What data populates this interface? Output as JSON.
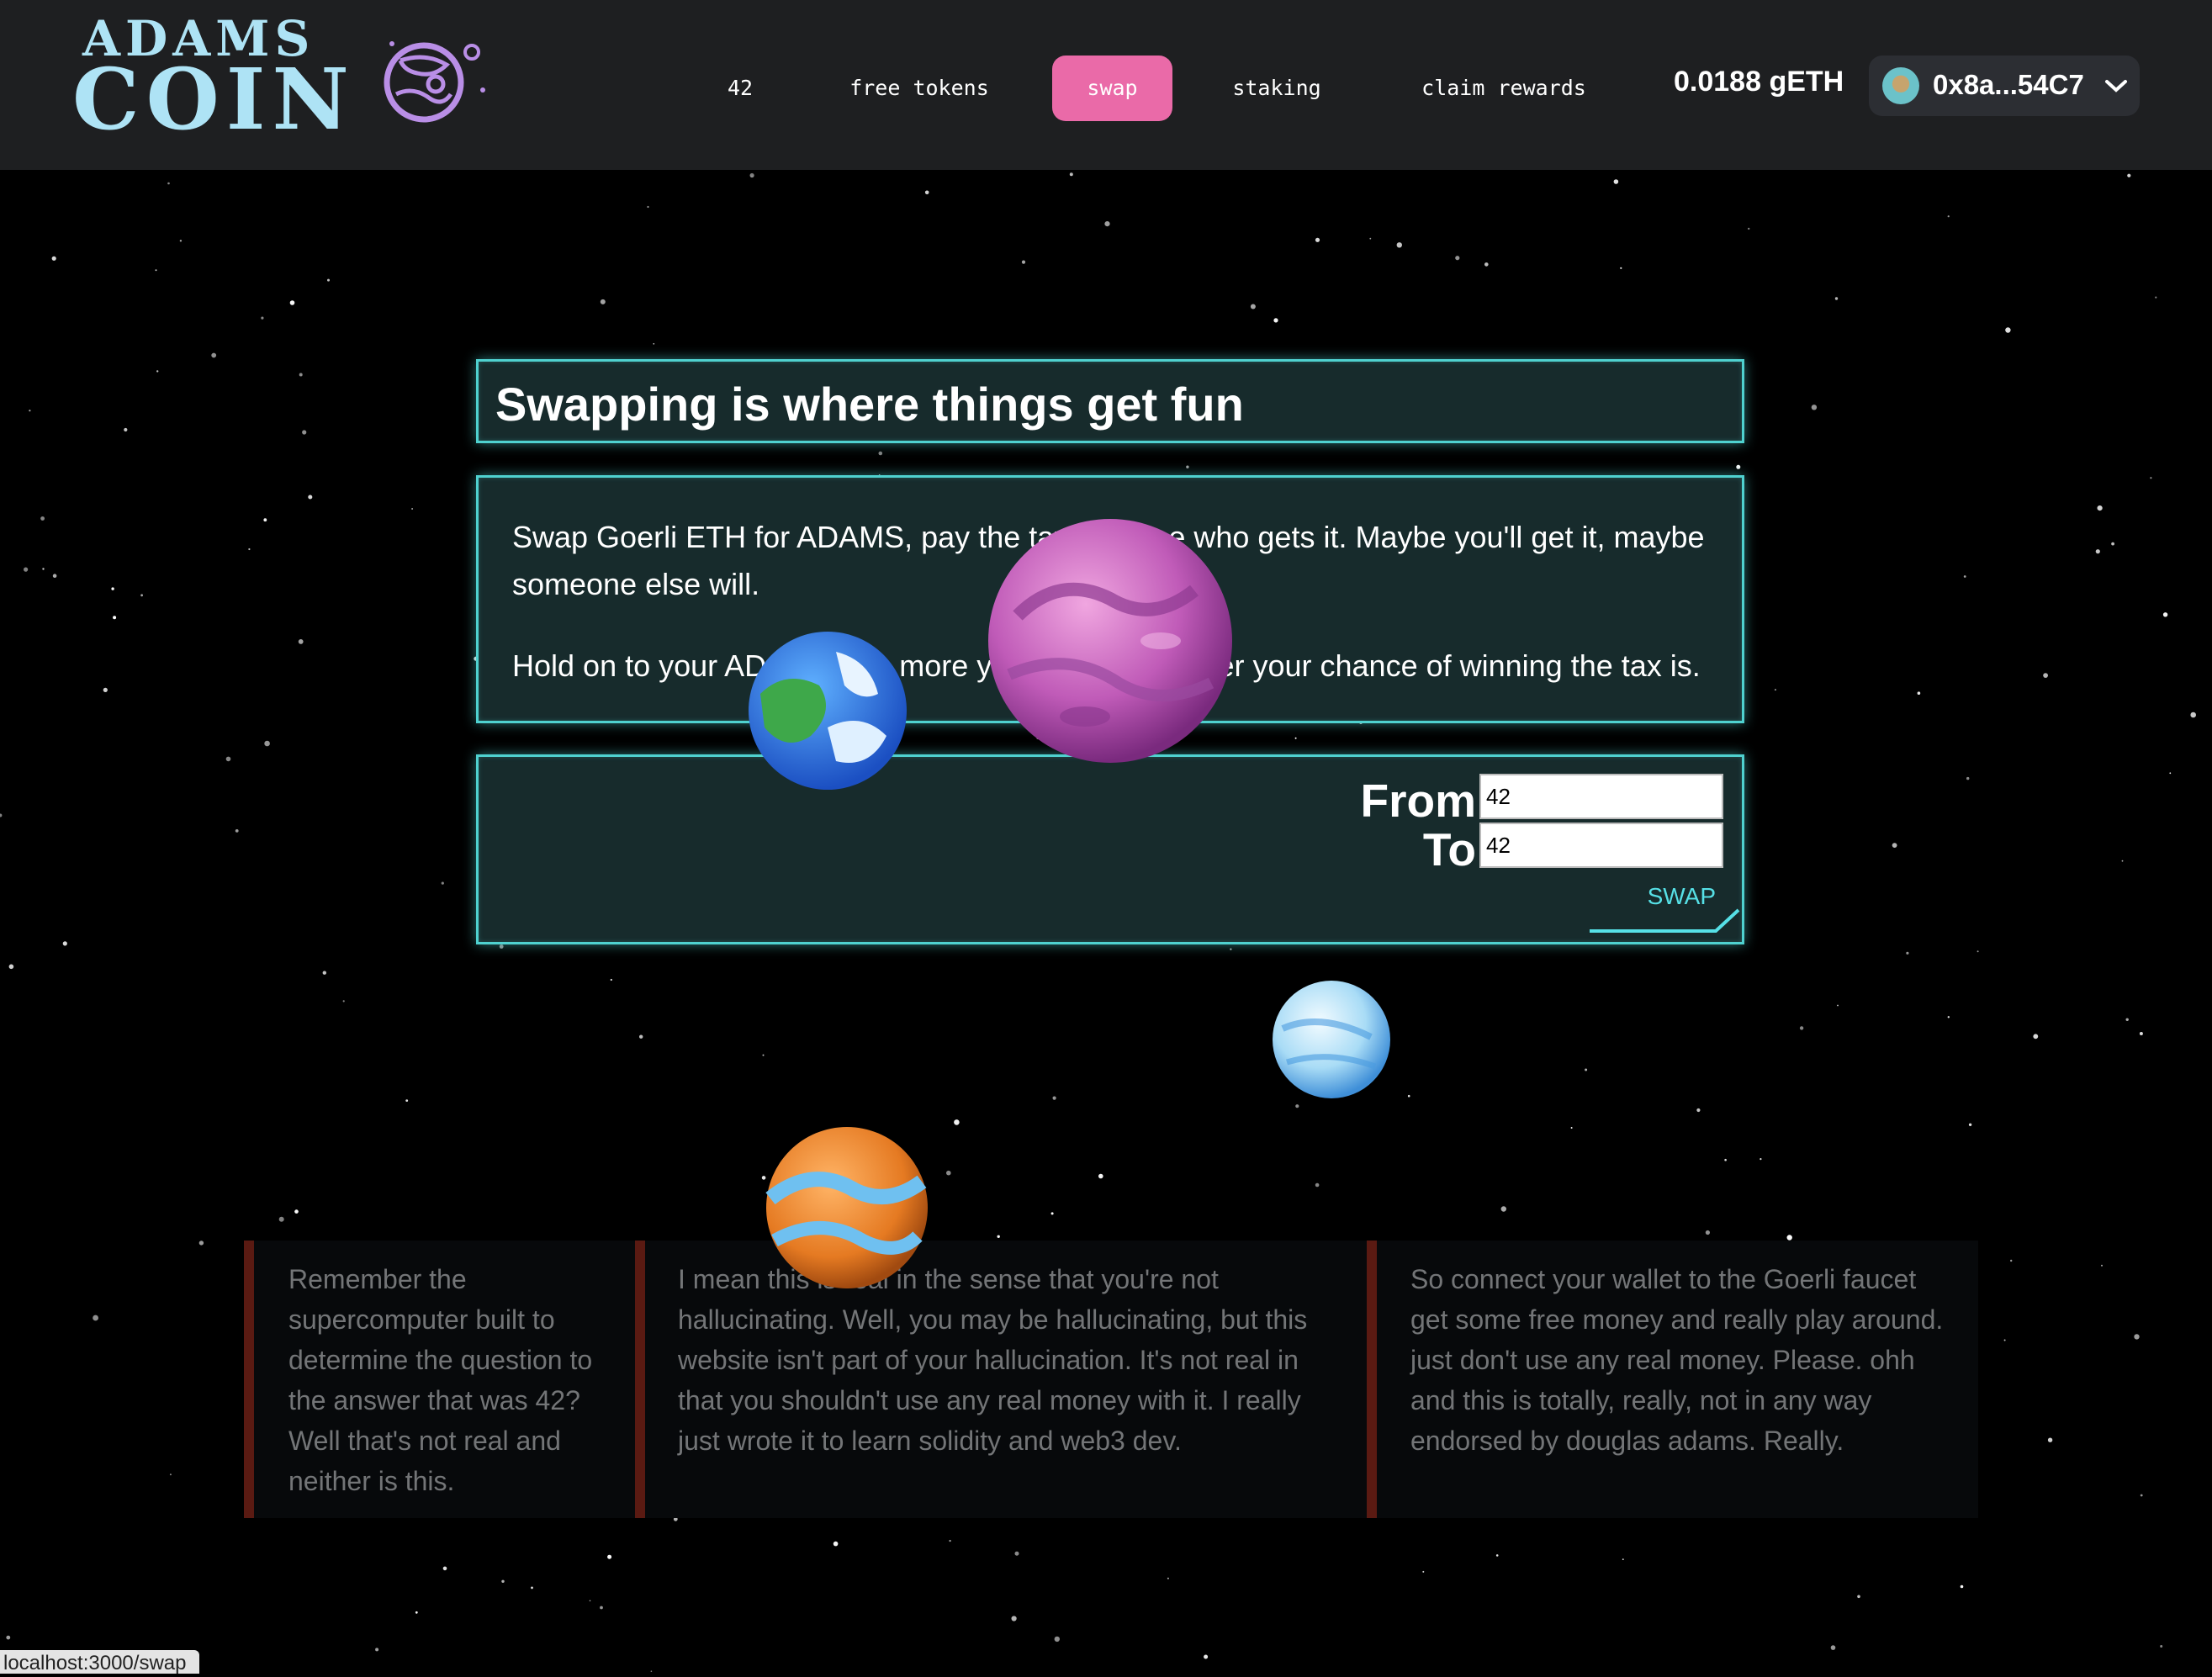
{
  "logo": {
    "line1": "ADAMS",
    "line2": "COIN",
    "icon": "planet-icon"
  },
  "nav": {
    "items": [
      {
        "label": "42",
        "active": false
      },
      {
        "label": "free tokens",
        "active": false
      },
      {
        "label": "swap",
        "active": true
      },
      {
        "label": "staking",
        "active": false
      },
      {
        "label": "claim rewards",
        "active": false
      }
    ]
  },
  "wallet": {
    "balance": "0.0188 gETH",
    "address": "0x8a...54C7",
    "avatar_icon": "account-avatar-icon",
    "chevron_icon": "chevron-down-icon"
  },
  "page": {
    "title": "Swapping is where things get fun",
    "description": [
      "Swap Goerli ETH for ADAMS, pay the tax and see who gets it. Maybe you'll get it, maybe someone else will.",
      "Hold on to your ADAMS, the more you have, the better your chance of winning the tax is."
    ]
  },
  "swap": {
    "from_label": "From",
    "from_value": "42",
    "to_label": "To",
    "to_value": "42",
    "button_label": "SWAP"
  },
  "cards": [
    "Remember the supercomputer built to determine the question to the answer that was 42? Well that's not real and neither is this.",
    "I mean this is real in the sense that you're not hallucinating. Well, you may be hallucinating, but this website isn't part of your hallucination. It's not real in that you shouldn't use any real money with it. I really just wrote it to learn solidity and web3 dev.",
    "So connect your wallet to the Goerli faucet get some free money and really play around. just don't use any real money. Please. ohh and this is totally, really, not in any way endorsed by douglas adams. Really."
  ],
  "status_bar": {
    "url": "localhost:3000/swap"
  },
  "colors": {
    "accent_pink": "#ea6aa8",
    "panel_border": "#4fd1cf",
    "panel_bg": "#172b2c",
    "logo": "#aee3f5",
    "swap_button": "#56e0e6",
    "card_bar": "#5a1a12"
  }
}
